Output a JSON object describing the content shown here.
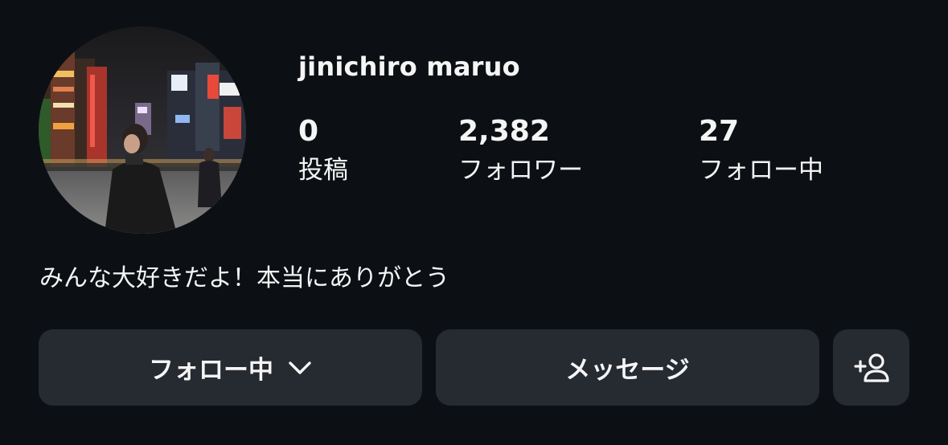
{
  "profile": {
    "username": "jinichiro maruo",
    "avatar_icon": "profile-photo-city-night",
    "bio": "みんな大好きだよ！本当にありがとう"
  },
  "stats": {
    "posts": {
      "count": "0",
      "label": "投稿"
    },
    "followers": {
      "count": "2,382",
      "label": "フォロワー"
    },
    "following": {
      "count": "27",
      "label": "フォロー中"
    }
  },
  "actions": {
    "following_label": "フォロー中",
    "following_icon": "chevron-down-icon",
    "message_label": "メッセージ",
    "add_user_icon": "add-person-icon"
  },
  "colors": {
    "background": "#0c1014",
    "button": "#262a31",
    "text": "#f5f5f5"
  }
}
